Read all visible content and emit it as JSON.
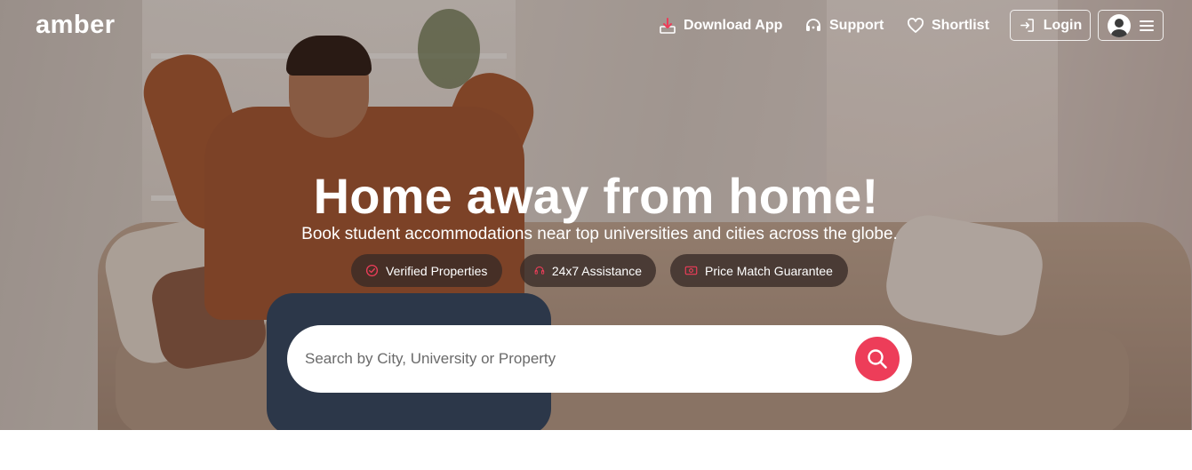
{
  "brand": {
    "logo_text": "amber",
    "accent_color": "#ed3d59"
  },
  "nav": {
    "download": {
      "label": "Download App",
      "icon": "download-icon"
    },
    "support": {
      "label": "Support",
      "icon": "headset-icon"
    },
    "shortlist": {
      "label": "Shortlist",
      "icon": "heart-icon"
    },
    "login": {
      "label": "Login",
      "icon": "login-icon"
    },
    "account": {
      "icon": "user-avatar-icon",
      "menu_icon": "hamburger-menu-icon"
    }
  },
  "hero": {
    "headline": "Home away from home!",
    "subline": "Book student accommodations near top universities and cities across the globe.",
    "badges": [
      {
        "label": "Verified Properties",
        "icon": "check-circle-icon"
      },
      {
        "label": "24x7 Assistance",
        "icon": "headset-icon"
      },
      {
        "label": "Price Match Guarantee",
        "icon": "money-icon"
      }
    ]
  },
  "search": {
    "placeholder": "Search by City, University or Property",
    "value": "",
    "button_icon": "search-icon"
  }
}
